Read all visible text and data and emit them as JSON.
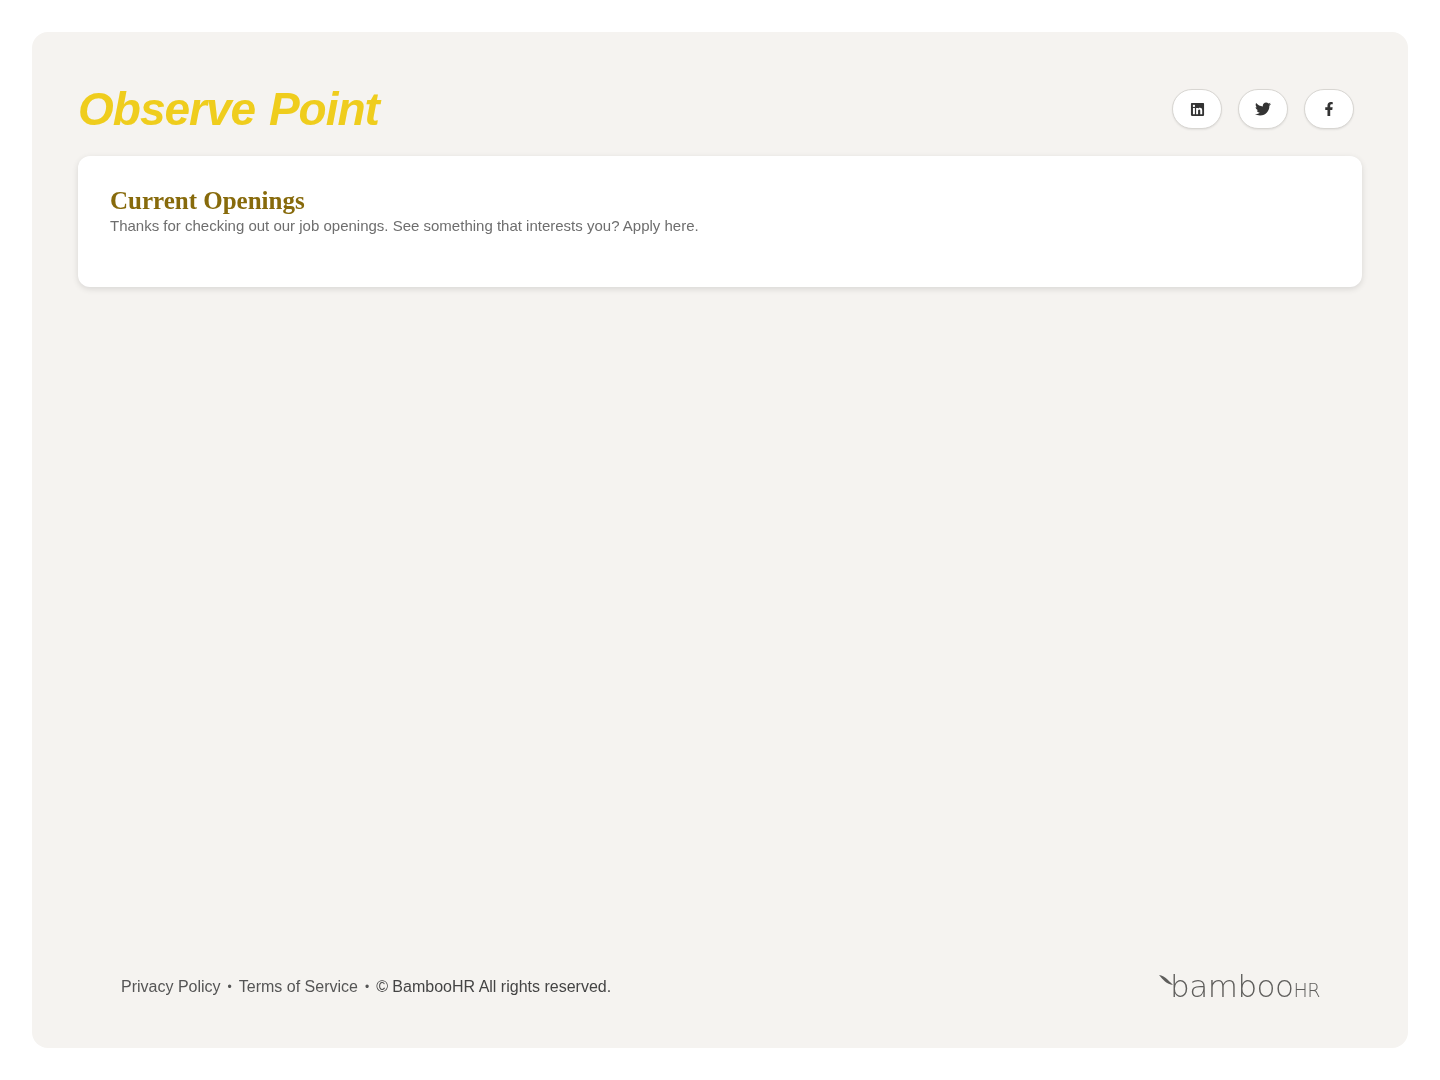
{
  "header": {
    "logo": {
      "text": "Observe Point"
    },
    "social_links": [
      {
        "kind": "linkedin"
      },
      {
        "kind": "twitter"
      },
      {
        "kind": "facebook"
      }
    ]
  },
  "openings": {
    "title": "Current Openings",
    "description": "Thanks for checking out our job openings. See something that interests you? Apply here."
  },
  "footer": {
    "items": [
      {
        "kind": "link",
        "text": "Privacy Policy"
      },
      {
        "kind": "separator",
        "text": "•"
      },
      {
        "kind": "link",
        "text": "Terms of Service"
      },
      {
        "kind": "separator",
        "text": "•"
      },
      {
        "kind": "text",
        "text": "© BambooHR All rights reserved."
      }
    ],
    "logo": {
      "word": "bamboo",
      "suffix": "HR"
    }
  }
}
